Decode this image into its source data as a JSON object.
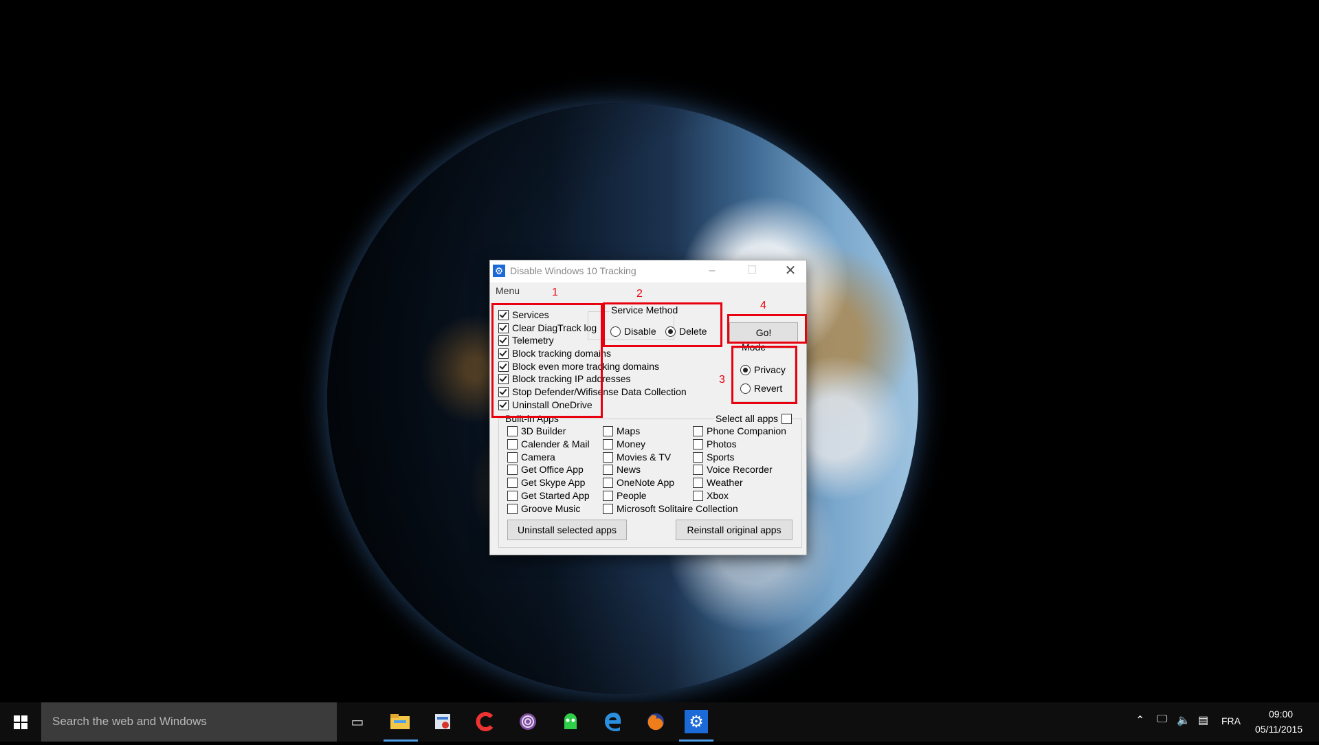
{
  "window": {
    "title": "Disable Windows 10 Tracking",
    "menu": "Menu",
    "tracking_options": [
      {
        "label": "Services",
        "checked": true
      },
      {
        "label": "Clear DiagTrack log",
        "checked": true
      },
      {
        "label": "Telemetry",
        "checked": true
      },
      {
        "label": "Block tracking domains",
        "checked": true
      },
      {
        "label": "Block even more tracking domains",
        "checked": true
      },
      {
        "label": "Block tracking IP addresses",
        "checked": true
      },
      {
        "label": "Stop Defender/Wifisense Data Collection",
        "checked": true
      },
      {
        "label": "Uninstall OneDrive",
        "checked": true
      }
    ],
    "service_method": {
      "label": "Service Method",
      "options": [
        {
          "label": "Disable",
          "selected": false
        },
        {
          "label": "Delete",
          "selected": true
        }
      ]
    },
    "go_button": "Go!",
    "mode": {
      "label": "Mode",
      "options": [
        {
          "label": "Privacy",
          "selected": true
        },
        {
          "label": "Revert",
          "selected": false
        }
      ]
    },
    "apps": {
      "label": "Built-in Apps",
      "select_all": "Select all apps",
      "col1": [
        "3D Builder",
        "Calender & Mail",
        "Camera",
        "Get Office App",
        "Get Skype App",
        "Get Started App",
        "Groove Music"
      ],
      "col2": [
        "Maps",
        "Money",
        "Movies & TV",
        "News",
        "OneNote App",
        "People",
        "Microsoft Solitaire Collection"
      ],
      "col3": [
        "Phone Companion",
        "Photos",
        "Sports",
        "Voice Recorder",
        "Weather",
        "Xbox"
      ],
      "uninstall_button": "Uninstall selected apps",
      "reinstall_button": "Reinstall original apps"
    },
    "annotations": [
      "1",
      "2",
      "3",
      "4"
    ],
    "annotation_color": "#e8000f"
  },
  "taskbar": {
    "search_placeholder": "Search the web and Windows",
    "language": "FRA",
    "time": "09:00",
    "date": "05/11/2015",
    "apps": [
      "task-view-icon",
      "file-explorer-icon",
      "app-icon",
      "ccleaner-icon",
      "tor-icon",
      "vpn-icon",
      "edge-icon",
      "firefox-icon",
      "settings-icon"
    ]
  }
}
